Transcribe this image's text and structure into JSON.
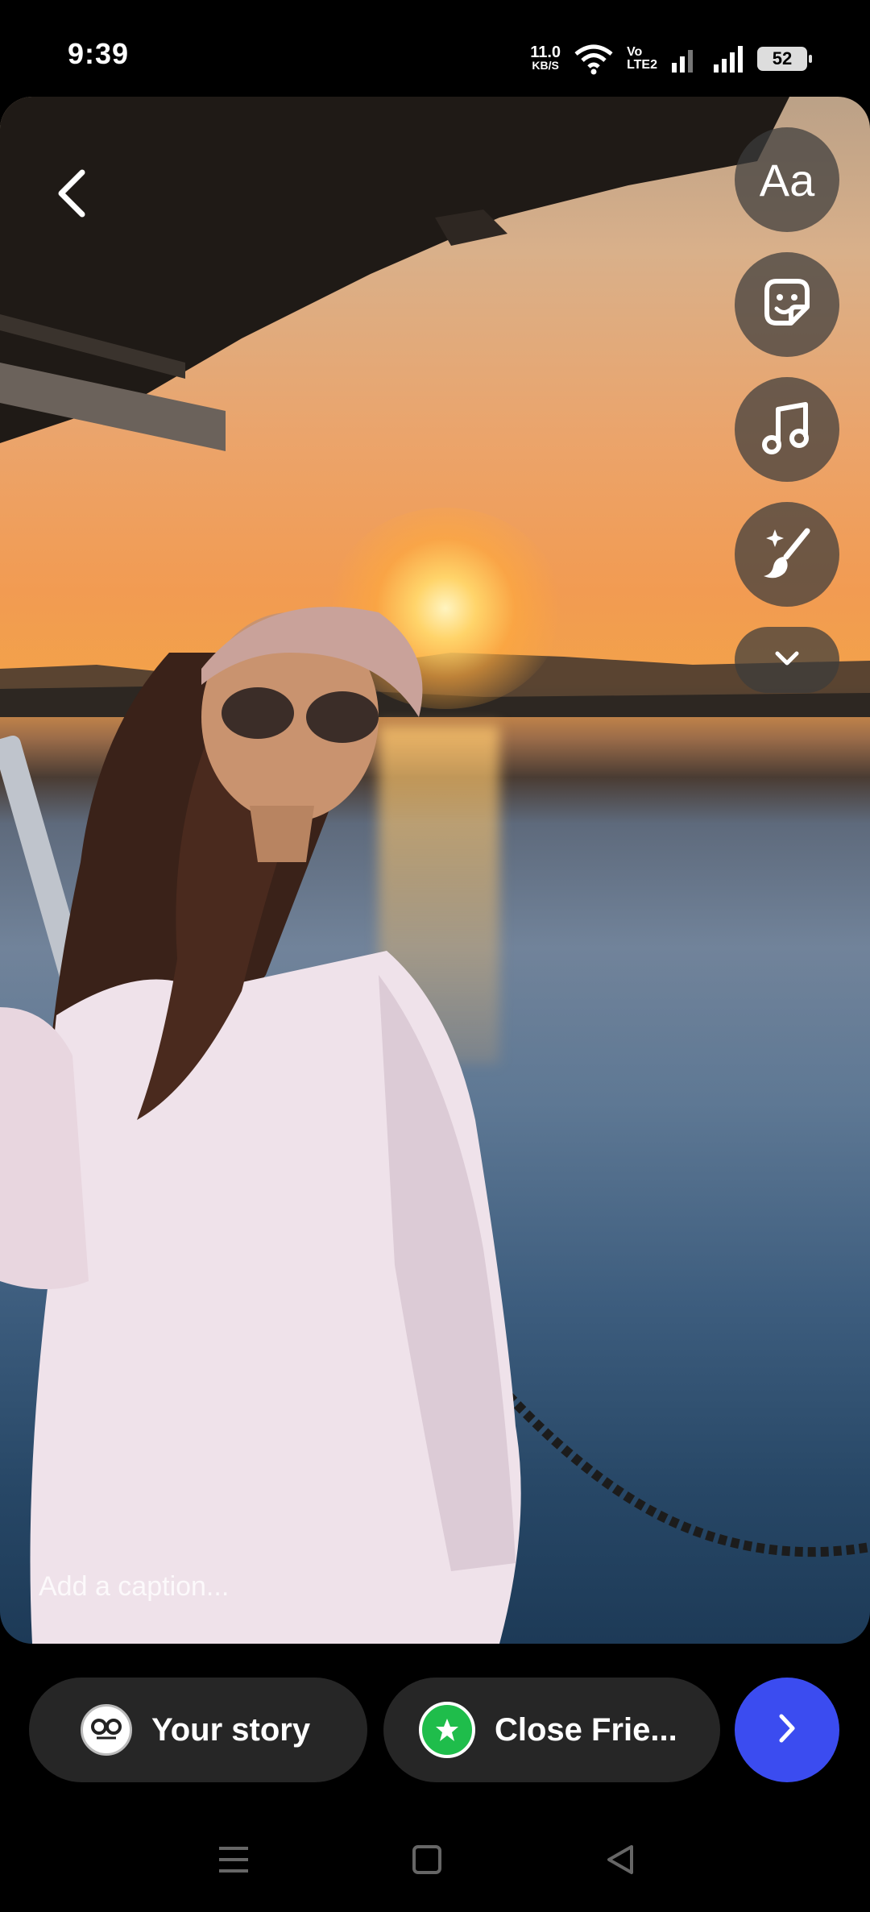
{
  "status_bar": {
    "time": "9:39",
    "net_speed": "11.0",
    "net_unit": "KB/S",
    "volte_top": "Vo",
    "volte_bottom": "LTE2",
    "battery": "52"
  },
  "editor": {
    "text_tool_label": "Aa",
    "icons": [
      "back-icon",
      "sticker-icon",
      "music-note-icon",
      "sparkle-brush-icon",
      "chevron-down-icon"
    ]
  },
  "caption": {
    "placeholder": "Add a caption..."
  },
  "share": {
    "your_story_label": "Your story",
    "close_friends_label": "Close Frie...",
    "accent_color": "#3b4cf0",
    "close_friends_color": "#1fbd4b"
  },
  "nav_bar": {
    "icons": [
      "menu-icon",
      "home-square-icon",
      "back-triangle-icon"
    ]
  }
}
